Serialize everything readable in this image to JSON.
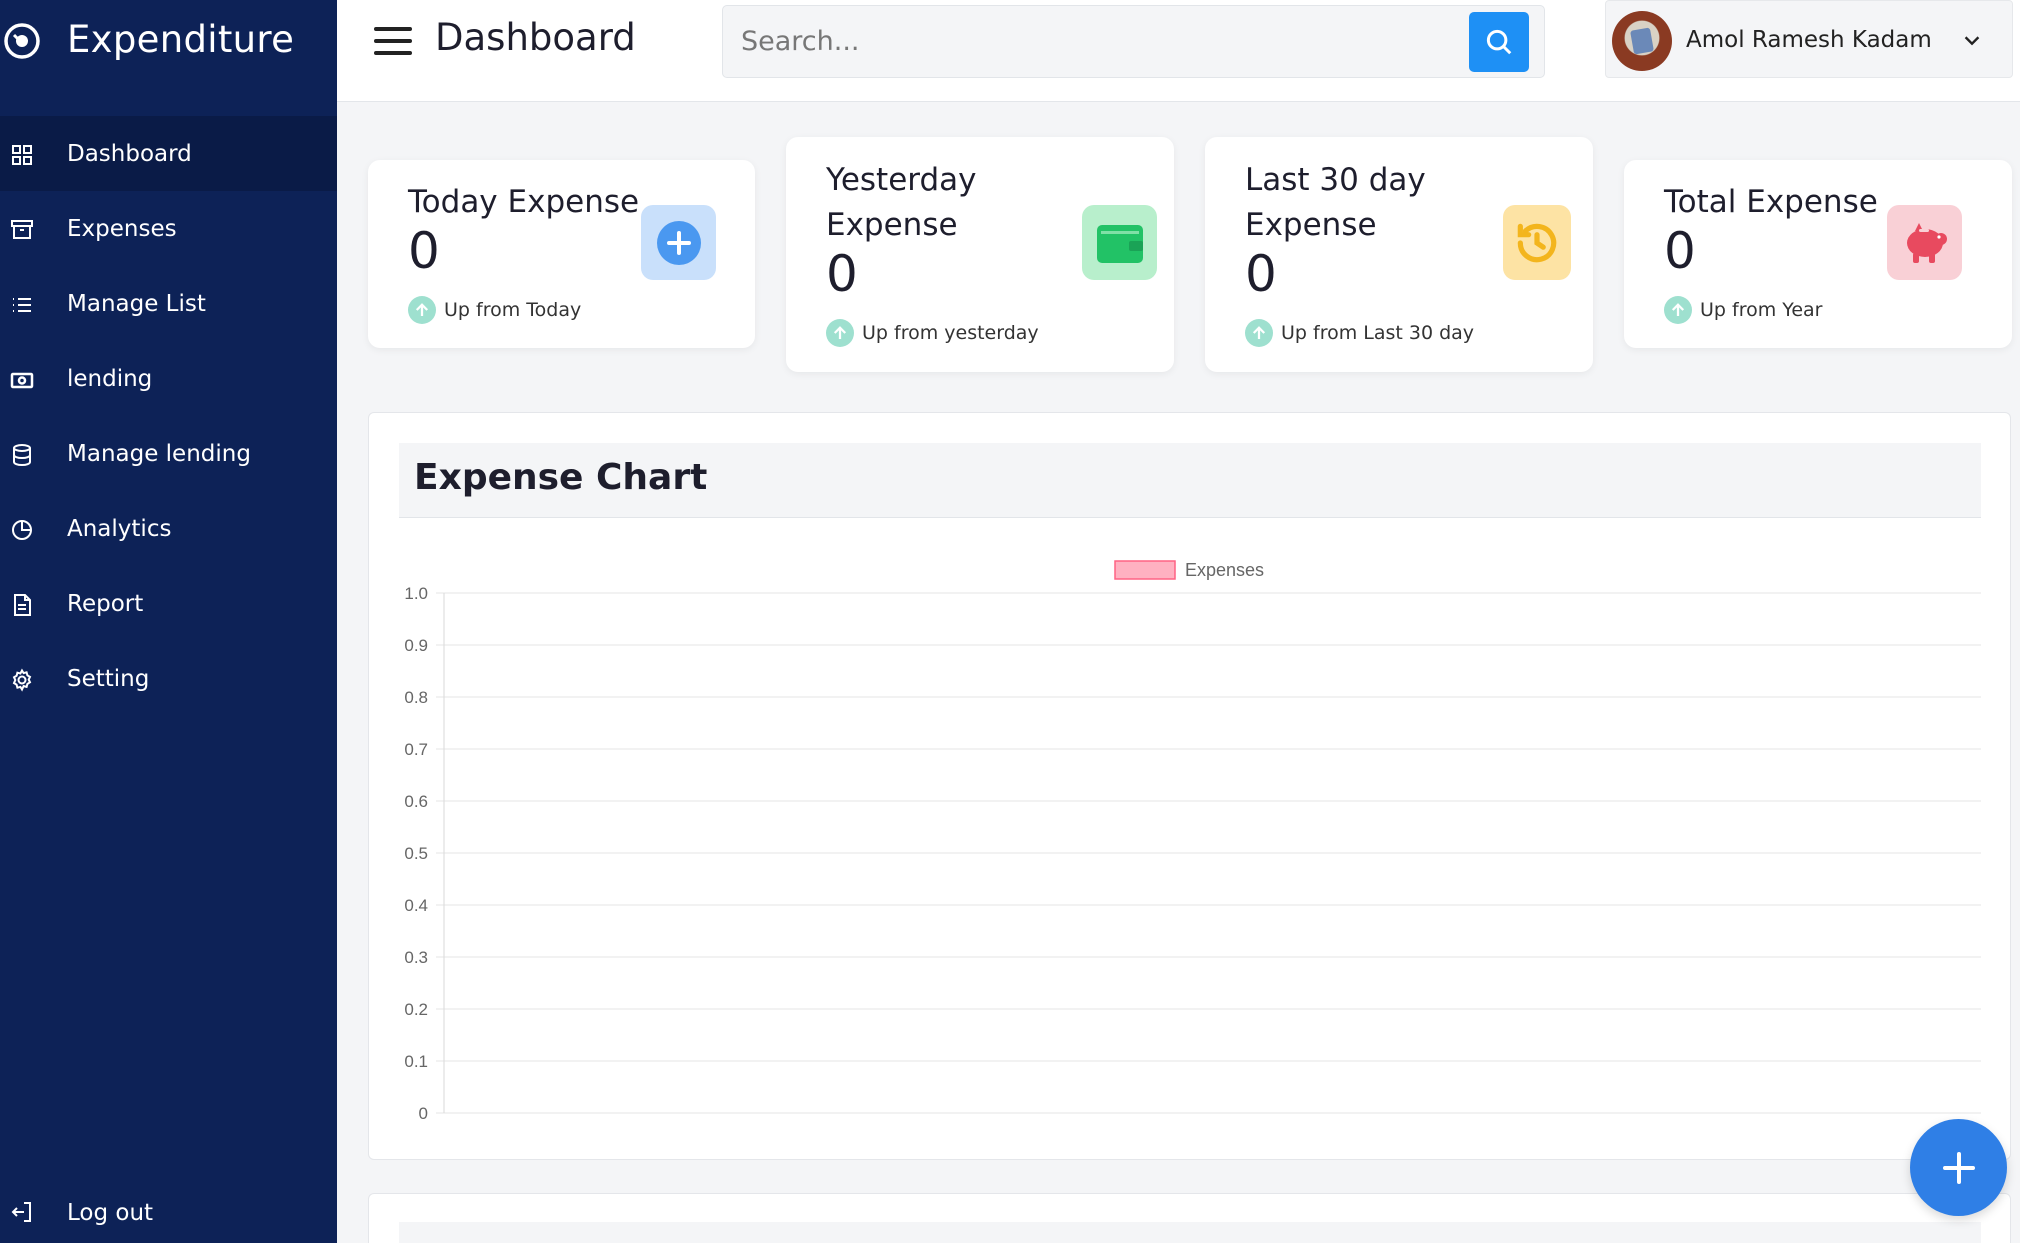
{
  "app": {
    "title": "Expenditure"
  },
  "sidebar": {
    "items": [
      {
        "label": "Dashboard",
        "icon": "grid-icon",
        "active": true
      },
      {
        "label": "Expenses",
        "icon": "archive-icon",
        "active": false
      },
      {
        "label": "Manage List",
        "icon": "list-icon",
        "active": false
      },
      {
        "label": "lending",
        "icon": "cash-icon",
        "active": false
      },
      {
        "label": "Manage lending",
        "icon": "database-icon",
        "active": false
      },
      {
        "label": "Analytics",
        "icon": "pie-chart-icon",
        "active": false
      },
      {
        "label": "Report",
        "icon": "document-icon",
        "active": false
      },
      {
        "label": "Setting",
        "icon": "gear-icon",
        "active": false
      }
    ],
    "logout": {
      "label": "Log out",
      "icon": "logout-icon"
    }
  },
  "header": {
    "title": "Dashboard",
    "search": {
      "placeholder": "Search...",
      "value": ""
    },
    "user": {
      "name": "Amol Ramesh Kadam"
    }
  },
  "cards": [
    {
      "title": "Today Expense",
      "value": "0",
      "trend": "Up from Today",
      "icon": "plus-circle-icon",
      "color": "#4a98f0",
      "bg": "#c9e0fb"
    },
    {
      "title_line1": "Yesterday",
      "title_line2": "Expense",
      "value": "0",
      "trend": "Up from yesterday",
      "icon": "wallet-icon",
      "color": "#22c266",
      "bg": "#b8efcc"
    },
    {
      "title_line1": "Last 30 day",
      "title_line2": "Expense",
      "value": "0",
      "trend": "Up from Last 30 day",
      "icon": "history-icon",
      "color": "#f3b51d",
      "bg": "#fde3a4"
    },
    {
      "title": "Total Expense",
      "value": "0",
      "trend": "Up from Year",
      "icon": "piggy-bank-icon",
      "color": "#e84a5f",
      "bg": "#f9d0d6"
    }
  ],
  "chart_panel": {
    "title": "Expense Chart"
  },
  "chart_data": {
    "type": "bar",
    "categories": [],
    "series": [
      {
        "name": "Expenses",
        "values": [],
        "color": "#ff6384"
      }
    ],
    "ylim": [
      0,
      1
    ],
    "yticks": [
      "1.0",
      "0.9",
      "0.8",
      "0.7",
      "0.6",
      "0.5",
      "0.4",
      "0.3",
      "0.2",
      "0.1",
      "0"
    ],
    "grid": true,
    "legend": "top"
  },
  "fab": {
    "icon": "plus-icon"
  }
}
